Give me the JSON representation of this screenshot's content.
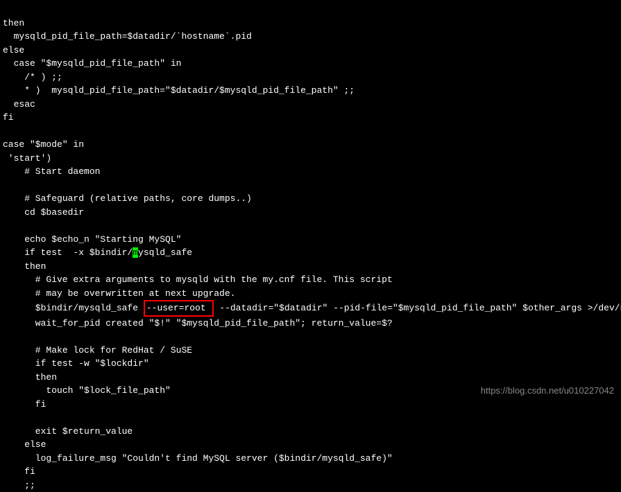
{
  "code": {
    "line1": "then",
    "line2": "  mysqld_pid_file_path=$datadir/`hostname`.pid",
    "line3": "else",
    "line4": "  case \"$mysqld_pid_file_path\" in",
    "line5": "    /* ) ;;",
    "line6": "    * )  mysqld_pid_file_path=\"$datadir/$mysqld_pid_file_path\" ;;",
    "line7": "  esac",
    "line8": "fi",
    "line9": "",
    "line10": "case \"$mode\" in",
    "line11": " 'start')",
    "line12": "    # Start daemon",
    "line13": "",
    "line14": "    # Safeguard (relative paths, core dumps..)",
    "line15": "    cd $basedir",
    "line16": "",
    "line17": "    echo $echo_n \"Starting MySQL\"",
    "line18_pre": "    if test  -x $bindir/",
    "line18_cursor": "m",
    "line18_post": "ysqld_safe",
    "line19": "    then",
    "line20": "      # Give extra arguments to mysqld with the my.cnf file. This script",
    "line21": "      # may be overwritten at next upgrade.",
    "line22_pre": "      $bindir/mysqld_safe ",
    "line22_box": "--user=root ",
    "line22_post": " --datadir=\"$datadir\" --pid-file=\"$mysqld_pid_file_path\" $other_args >/dev/null &",
    "line23": "      wait_for_pid created \"$!\" \"$mysqld_pid_file_path\"; return_value=$?",
    "line24": "",
    "line25": "      # Make lock for RedHat / SuSE",
    "line26": "      if test -w \"$lockdir\"",
    "line27": "      then",
    "line28": "        touch \"$lock_file_path\"",
    "line29": "      fi",
    "line30": "",
    "line31": "      exit $return_value",
    "line32": "    else",
    "line33": "      log_failure_msg \"Couldn't find MySQL server ($bindir/mysqld_safe)\"",
    "line34": "    fi",
    "line35": "    ;;"
  },
  "watermark": "https://blog.csdn.net/u010227042"
}
